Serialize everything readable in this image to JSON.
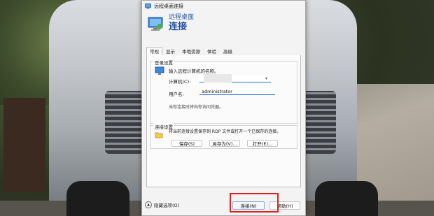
{
  "window": {
    "title": "远程桌面连接"
  },
  "banner": {
    "subtitle": "远程桌面",
    "title": "连接"
  },
  "tabs": [
    "常规",
    "显示",
    "本地资源",
    "体验",
    "高级"
  ],
  "login": {
    "group_title": "登录设置",
    "hint": "输入远程计算机的名称。",
    "computer_label": "计算机(C):",
    "username_label": "用户名:",
    "username_value": "administrator",
    "note": "当你连接时将向你询问凭据。"
  },
  "connection": {
    "group_title": "连接设置",
    "description": "将当前连接设置保存到 RDP 文件或打开一个已保存的连接。",
    "save_label": "保存(S)",
    "save_as_label": "另存为(V)...",
    "open_label": "打开(E)..."
  },
  "footer": {
    "hide_options_label": "隐藏选项(O)",
    "connect_label": "连接(N)",
    "help_label": "帮助(H)"
  },
  "colors": {
    "accent": "#1d4f9c",
    "highlight": "#e22020"
  }
}
